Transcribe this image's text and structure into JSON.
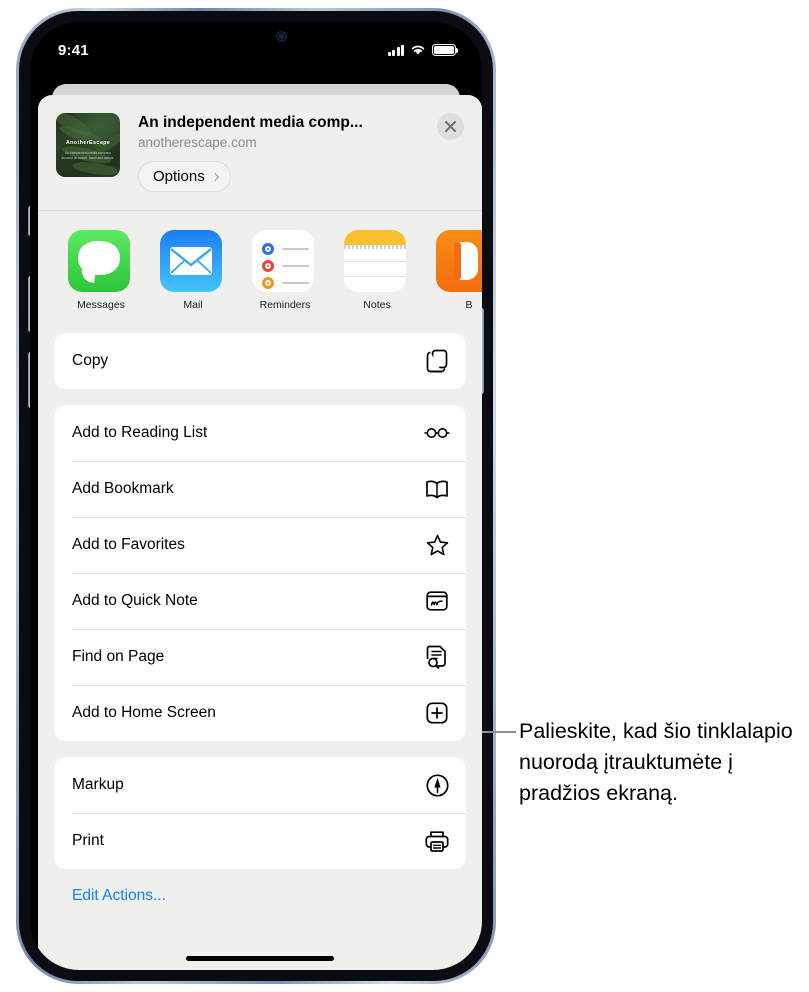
{
  "statusbar": {
    "time": "9:41",
    "signal_icon": "cellular-bars-icon",
    "wifi_icon": "wifi-icon",
    "battery_icon": "battery-full-icon"
  },
  "share_sheet": {
    "header": {
      "thumbnail_icon": "page-thumbnail-fern-image",
      "thumbnail_title": "AnotherEscape",
      "thumbnail_caption": "An independent media company focused on nature, travel and culture.",
      "title": "An independent media comp...",
      "url": "anotherescape.com",
      "options_label": "Options",
      "options_chevron_icon": "chevron-right-icon",
      "close_icon": "close-icon"
    },
    "apps": [
      {
        "label": "Messages",
        "icon": "messages-app-icon"
      },
      {
        "label": "Mail",
        "icon": "mail-app-icon"
      },
      {
        "label": "Reminders",
        "icon": "reminders-app-icon"
      },
      {
        "label": "Notes",
        "icon": "notes-app-icon"
      },
      {
        "label": "B",
        "icon": "books-app-icon"
      }
    ],
    "groups": [
      {
        "rows": [
          {
            "label": "Copy",
            "icon": "copy-icon"
          }
        ]
      },
      {
        "rows": [
          {
            "label": "Add to Reading List",
            "icon": "glasses-icon"
          },
          {
            "label": "Add Bookmark",
            "icon": "book-open-icon"
          },
          {
            "label": "Add to Favorites",
            "icon": "star-icon"
          },
          {
            "label": "Add to Quick Note",
            "icon": "quick-note-icon"
          },
          {
            "label": "Find on Page",
            "icon": "find-on-page-icon"
          },
          {
            "label": "Add to Home Screen",
            "icon": "plus-square-icon"
          }
        ]
      },
      {
        "rows": [
          {
            "label": "Markup",
            "icon": "markup-pen-icon"
          },
          {
            "label": "Print",
            "icon": "printer-icon"
          }
        ]
      }
    ],
    "edit_actions_label": "Edit Actions...",
    "home_indicator": "home-indicator"
  },
  "callout": {
    "text": "Palieskite, kad šio tinklalapio nuorodą įtrauktumėte į pradžios ekraną."
  },
  "colors": {
    "sheet_background": "#eff0ee",
    "row_background": "#ffffff",
    "link_blue": "#0a84ff",
    "secondary_text": "#8a8a8e",
    "callout_line": "#8e8e93"
  }
}
